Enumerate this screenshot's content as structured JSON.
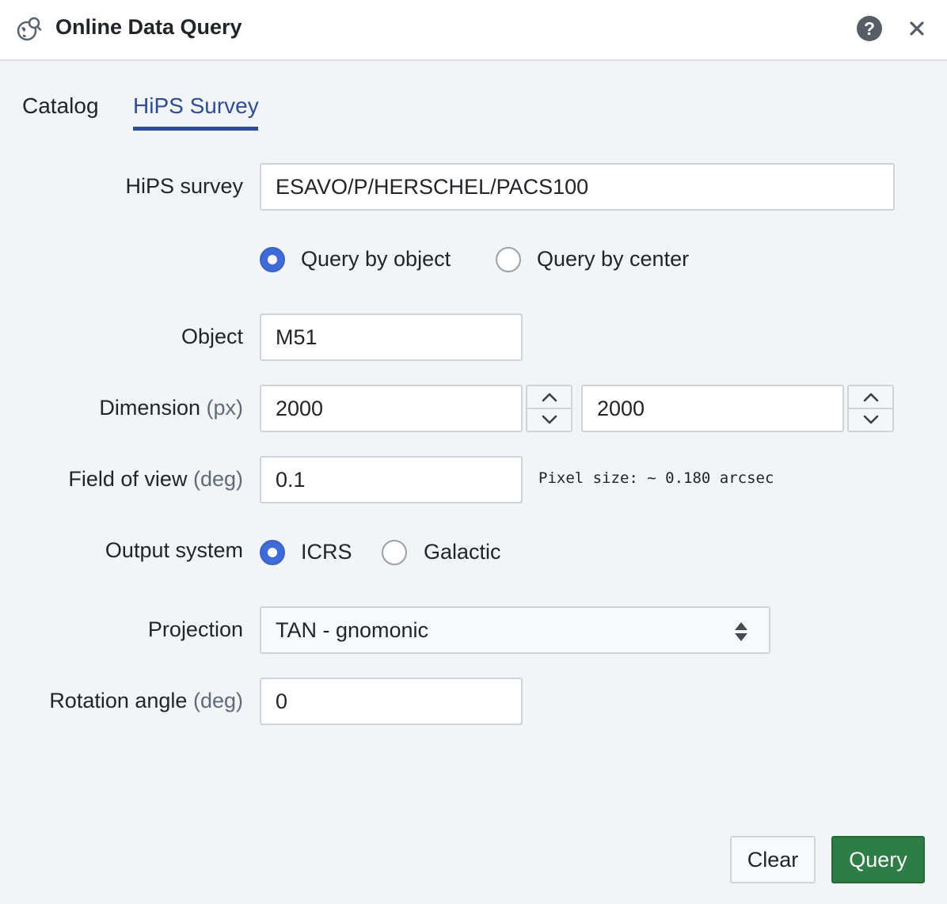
{
  "header": {
    "title": "Online Data Query",
    "app_icon": "globe-search-icon",
    "help_icon": "question-circle-icon",
    "close_icon": "close-icon"
  },
  "tabs": [
    {
      "label": "Catalog",
      "active": false
    },
    {
      "label": "HiPS Survey",
      "active": true
    }
  ],
  "form": {
    "hips_survey": {
      "label": "HiPS survey",
      "value": "ESAVO/P/HERSCHEL/PACS100"
    },
    "query_mode": {
      "options": [
        "Query by object",
        "Query by center"
      ],
      "selected": "Query by object"
    },
    "object": {
      "label": "Object",
      "value": "M51"
    },
    "dimension": {
      "label": "Dimension",
      "unit": "(px)",
      "width": "2000",
      "height": "2000"
    },
    "fov": {
      "label": "Field of view",
      "unit": "(deg)",
      "value": "0.1",
      "note": "Pixel size: ~ 0.180 arcsec"
    },
    "output_system": {
      "label": "Output system",
      "options": [
        "ICRS",
        "Galactic"
      ],
      "selected": "ICRS"
    },
    "projection": {
      "label": "Projection",
      "value": "TAN - gnomonic"
    },
    "rotation": {
      "label": "Rotation angle",
      "unit": "(deg)",
      "value": "0"
    }
  },
  "buttons": {
    "clear": "Clear",
    "query": "Query"
  },
  "colors": {
    "accent": "#2a4d9f",
    "radio_selected": "#3c6cd9",
    "query_button": "#2f7d46",
    "background": "#f3f4f6"
  }
}
